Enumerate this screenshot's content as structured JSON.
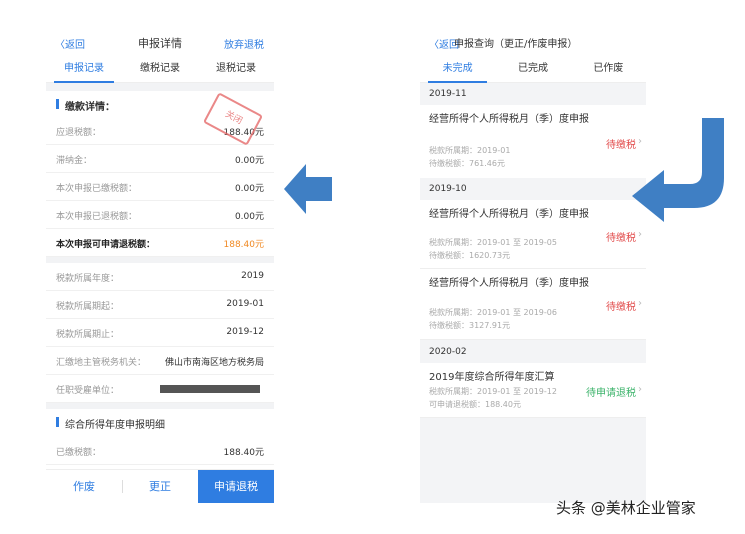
{
  "left": {
    "back": "〈返回",
    "title": "申报详情",
    "action": "放弃退税",
    "tabs": [
      "申报记录",
      "缴税记录",
      "退税记录"
    ],
    "section1_title": "缴款详情：",
    "stamp": "关闭",
    "rows1": [
      {
        "k": "应退税额：",
        "v": "188.40元"
      },
      {
        "k": "滞纳金：",
        "v": "0.00元"
      },
      {
        "k": "本次申报已缴税额：",
        "v": "0.00元"
      },
      {
        "k": "本次申报已退税额：",
        "v": "0.00元"
      }
    ],
    "highlight": {
      "k": "本次申报可申请退税额：",
      "v": "188.40元"
    },
    "rows2": [
      {
        "k": "税款所属年度：",
        "v": "2019"
      },
      {
        "k": "税款所属期起：",
        "v": "2019-01"
      },
      {
        "k": "税款所属期止：",
        "v": "2019-12"
      },
      {
        "k": "汇缴地主管税务机关：",
        "v": "佛山市南海区地方税务局"
      },
      {
        "k": "任职受雇单位：",
        "v": ""
      }
    ],
    "section2_title": "综合所得年度申报明细",
    "rows3": [
      {
        "k": "已缴税额：",
        "v": "188.40元"
      }
    ],
    "bottom": [
      "作废",
      "更正",
      "申请退税"
    ]
  },
  "right": {
    "back": "〈返回",
    "title": "申报查询（更正/作废申报）",
    "tabs": [
      "未完成",
      "已完成",
      "已作废"
    ],
    "groups": [
      {
        "label": "2019-11",
        "items": [
          {
            "title": "经营所得个人所得税月（季）度申报",
            "meta1": "税款所属期：2019-01",
            "meta2": "待缴税额：761.46元",
            "status": "待缴税"
          }
        ]
      },
      {
        "label": "2019-10",
        "items": [
          {
            "title": "经营所得个人所得税月（季）度申报",
            "meta1": "税款所属期：2019-01 至 2019-05",
            "meta2": "待缴税额：1620.73元",
            "status": "待缴税"
          },
          {
            "title": "经营所得个人所得税月（季）度申报",
            "meta1": "税款所属期：2019-01 至 2019-06",
            "meta2": "待缴税额：3127.91元",
            "status": "待缴税"
          }
        ]
      },
      {
        "label": "2020-02",
        "items": [
          {
            "title": "2019年度综合所得年度汇算",
            "meta1": "税款所属期：2019-01 至 2019-12",
            "meta2": "可申请退税额：188.40元",
            "status": "待申请退税"
          }
        ]
      }
    ]
  },
  "watermark": "头条 @美林企业管家",
  "colors": {
    "accent": "#2f7de1",
    "arrow": "#3f7fc4",
    "orange": "#f08a24",
    "red": "#e24b4b",
    "green": "#3bb36a"
  }
}
